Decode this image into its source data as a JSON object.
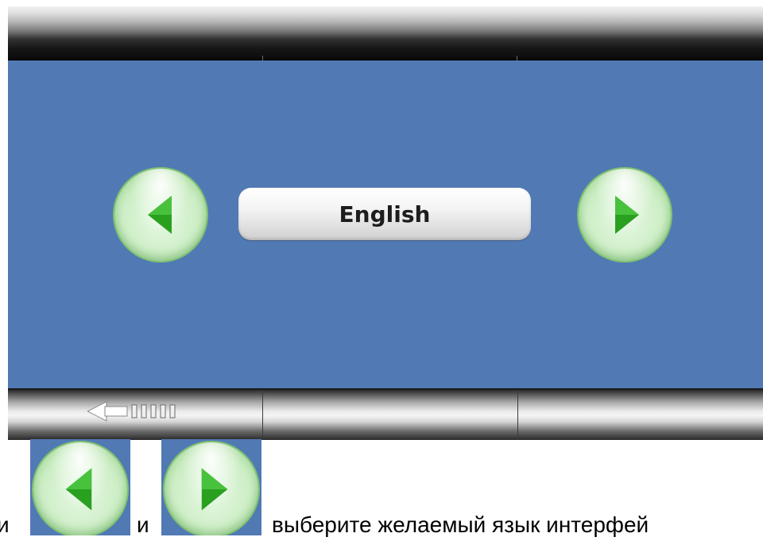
{
  "screen": {
    "language_label": "English"
  },
  "buttons": {
    "prev_icon": "left-arrow-icon",
    "next_icon": "right-arrow-icon",
    "back_icon": "back-arrow-icon"
  },
  "instruction": {
    "prefix": "и",
    "middle": "и",
    "suffix": "выберите желаемый язык интерфей"
  },
  "colors": {
    "screen_bg": "#5179b4",
    "arrow_green": "#2aa020"
  }
}
